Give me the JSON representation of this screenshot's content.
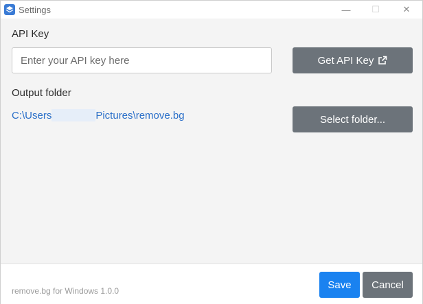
{
  "window": {
    "title": "Settings",
    "minimize_glyph": "—",
    "maximize_glyph": "☐",
    "close_glyph": "✕"
  },
  "api": {
    "label": "API Key",
    "value": "",
    "placeholder": "Enter your API key here",
    "get_key_label": "Get API Key",
    "external_icon": "external-link-icon"
  },
  "output": {
    "label": "Output folder",
    "path_start": "C:\\Users",
    "path_end": "Pictures\\remove.bg",
    "select_label": "Select folder..."
  },
  "footer": {
    "version": "remove.bg for Windows 1.0.0",
    "save_label": "Save",
    "cancel_label": "Cancel"
  },
  "colors": {
    "primary": "#1a82f0",
    "secondary": "#6c737a",
    "link": "#2a6fc9",
    "background": "#f4f4f4"
  }
}
